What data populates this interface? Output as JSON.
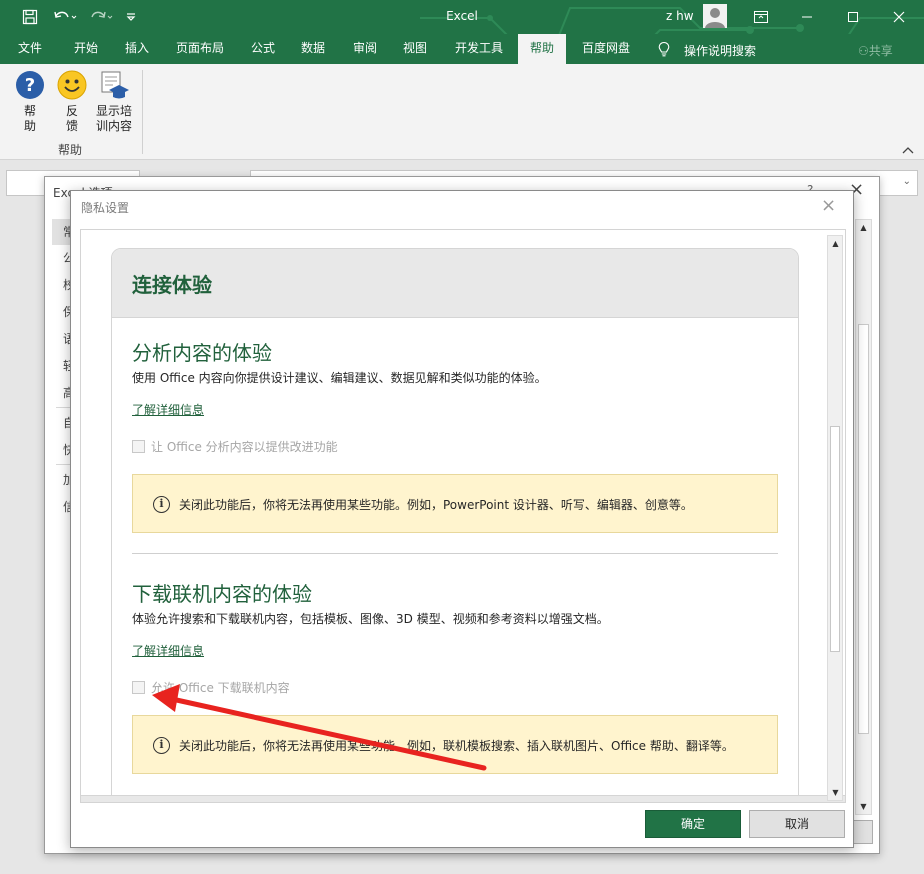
{
  "window": {
    "app_title": "Excel",
    "user_name": "z hw",
    "share_label": "共享"
  },
  "ribbon": {
    "tabs": [
      {
        "label": "文件"
      },
      {
        "label": "开始"
      },
      {
        "label": "插入"
      },
      {
        "label": "页面布局"
      },
      {
        "label": "公式"
      },
      {
        "label": "数据"
      },
      {
        "label": "审阅"
      },
      {
        "label": "视图"
      },
      {
        "label": "开发工具"
      },
      {
        "label": "帮助"
      },
      {
        "label": "百度网盘"
      }
    ],
    "active_tab": "帮助",
    "tell_me": "操作说明搜索",
    "help_group": {
      "help_label": "帮\n助",
      "feedback_label": "反\n馈",
      "training_label": "显示培\n训内容",
      "group_name": "帮助"
    }
  },
  "options_dialog": {
    "title": "Excel 选项",
    "help_glyph": "?",
    "nav_items": [
      {
        "label": "常规"
      },
      {
        "label": "公式"
      },
      {
        "label": "校对"
      },
      {
        "label": "保存"
      },
      {
        "label": "语言"
      },
      {
        "label": "轻松访问"
      },
      {
        "label": "高级"
      },
      {
        "label": "自定义功能区"
      },
      {
        "label": "快速访问工具栏"
      },
      {
        "label": "加载项"
      },
      {
        "label": "信任中心"
      }
    ]
  },
  "privacy_dialog": {
    "title": "隐私设置",
    "card_title": "连接体验",
    "analyze": {
      "title": "分析内容的体验",
      "desc": "使用 Office 内容向你提供设计建议、编辑建议、数据见解和类似功能的体验。",
      "learn_more": "了解详细信息",
      "checkbox_label": "让 Office 分析内容以提供改进功能",
      "checked": false,
      "notice": "关闭此功能后，你将无法再使用某些功能。例如，PowerPoint 设计器、听写、编辑器、创意等。"
    },
    "download": {
      "title": "下载联机内容的体验",
      "desc": "体验允许搜索和下载联机内容，包括模板、图像、3D 模型、视频和参考资料以增强文档。",
      "learn_more": "了解详细信息",
      "checkbox_label": "允许 Office 下载联机内容",
      "checked": false,
      "notice": "关闭此功能后，你将无法再使用某些功能。例如，联机模板搜索、插入联机图片、Office 帮助、翻译等。"
    },
    "ok_label": "确定",
    "cancel_label": "取消"
  },
  "colors": {
    "excel_green": "#217346",
    "heading_green": "#21613c",
    "notice_bg": "#fff4ce",
    "arrow_red": "#e8231f"
  }
}
